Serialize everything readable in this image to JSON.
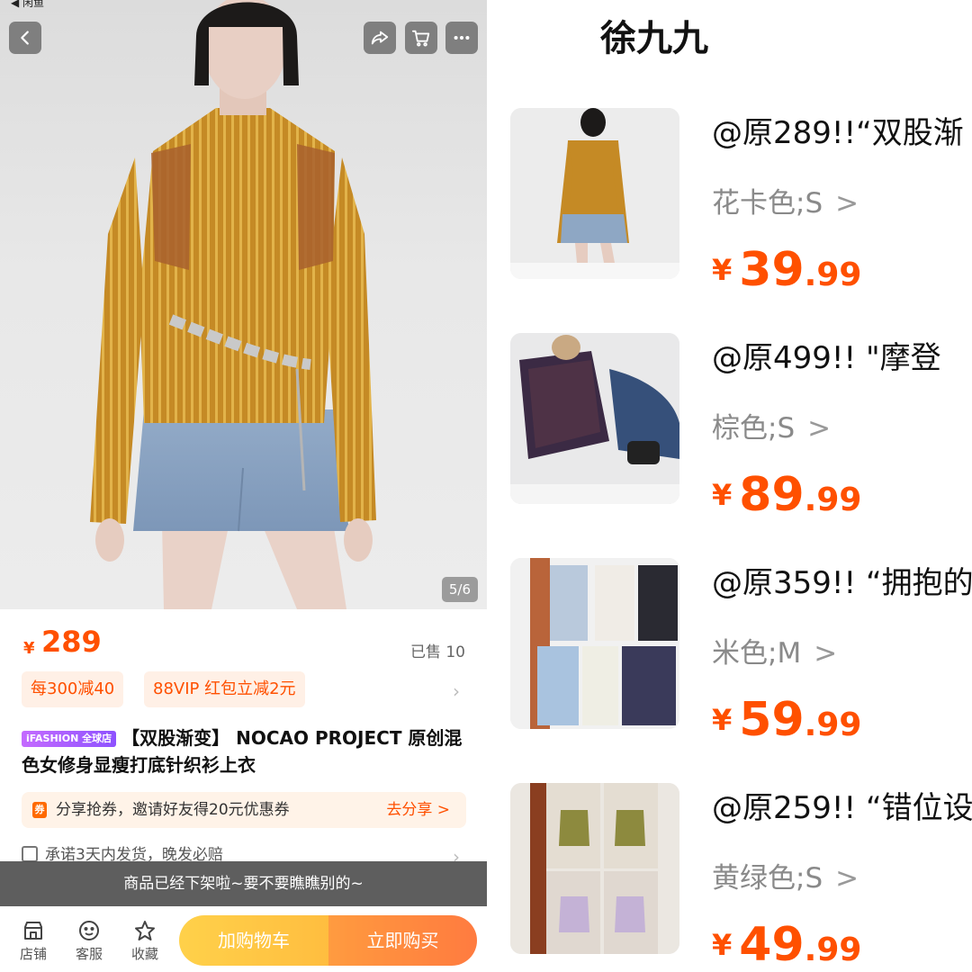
{
  "left": {
    "status_label": "◀ 闲鱼",
    "page_indicator": "5/6",
    "price_symbol": "¥",
    "price": "289",
    "sold": "已售 10",
    "coupons": [
      "每300减40",
      "88VIP 红包立减2元"
    ],
    "badge": "iFASHION 全球店",
    "title": "【双股渐变】 NOCAO PROJECT 原创混色女修身显瘦打底针织衫上衣",
    "share_icon": "券",
    "share_text": "分享抢券，邀请好友得20元优惠券",
    "share_cta": "去分享 >",
    "promise": "承诺3天内发货，晚发必赔",
    "toast": "商品已经下架啦~要不要瞧瞧别的~",
    "nav": [
      {
        "label": "店铺",
        "icon": "store-icon"
      },
      {
        "label": "客服",
        "icon": "service-icon"
      },
      {
        "label": "收藏",
        "icon": "star-icon"
      }
    ],
    "add_to_cart": "加购物车",
    "buy_now": "立即购买",
    "icons": [
      "back-icon",
      "share-icon",
      "cart-icon",
      "more-icon"
    ]
  },
  "right": {
    "shop_name": "徐九九",
    "items": [
      {
        "title": "@原289!!“双股渐",
        "variant": "花卡色;S",
        "price_symbol": "¥",
        "price_int": "39",
        "price_dec": ".99"
      },
      {
        "title": "@原499!!  \"摩登",
        "variant": "棕色;S",
        "price_symbol": "¥",
        "price_int": "89",
        "price_dec": ".99"
      },
      {
        "title": "@原359!! “拥抱的",
        "variant": "米色;M",
        "price_symbol": "¥",
        "price_int": "59",
        "price_dec": ".99"
      },
      {
        "title": "@原259!! “错位设",
        "variant": "黄绿色;S",
        "price_symbol": "¥",
        "price_int": "49",
        "price_dec": ".99"
      }
    ],
    "chevron": ">"
  },
  "colors": {
    "accent": "#ff5000",
    "coupon_bg": "#fff0e6",
    "cart_button": "#ffb000",
    "buy_button": "#ff5a00",
    "toast_bg": "#505050",
    "knit_mustard": "#c8922a",
    "denim": "#8ea7c4"
  }
}
